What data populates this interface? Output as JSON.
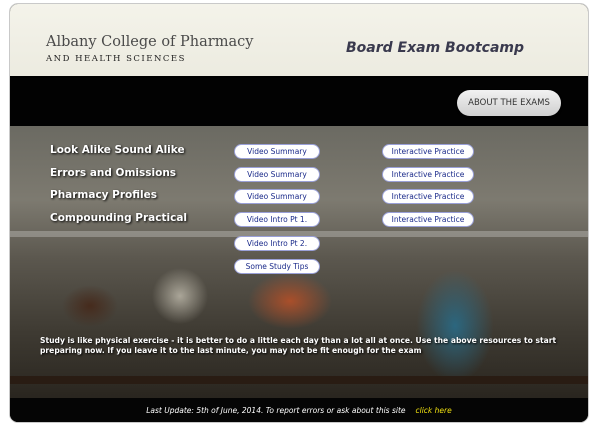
{
  "header": {
    "college_line1": "Albany College of Pharmacy",
    "college_line2": "AND HEALTH SCIENCES",
    "site_title": "Board Exam Bootcamp"
  },
  "nav": {
    "about_label": "ABOUT THE EXAMS"
  },
  "rows": [
    {
      "title": "Look Alike Sound Alike",
      "video": "Video Summary",
      "practice": "Interactive Practice"
    },
    {
      "title": "Errors and Omissions",
      "video": "Video Summary",
      "practice": "Interactive Practice"
    },
    {
      "title": "Pharmacy Profiles",
      "video": "Video Summary",
      "practice": "Interactive Practice"
    },
    {
      "title": "Compounding Practical",
      "video": "Video Intro Pt 1.",
      "practice": "Interactive Practice"
    }
  ],
  "extra_buttons": [
    "Video Intro Pt 2.",
    "Some Study Tips"
  ],
  "quote": "Study is like physical exercise - it is better to do a little each day than a lot all at once. Use the above resources to start preparing now. If you leave it to the last minute, you may not be fit enough for the exam",
  "footer": {
    "text": "Last Update: 5th of June, 2014. To report errors or ask about this site",
    "link": "click here"
  }
}
